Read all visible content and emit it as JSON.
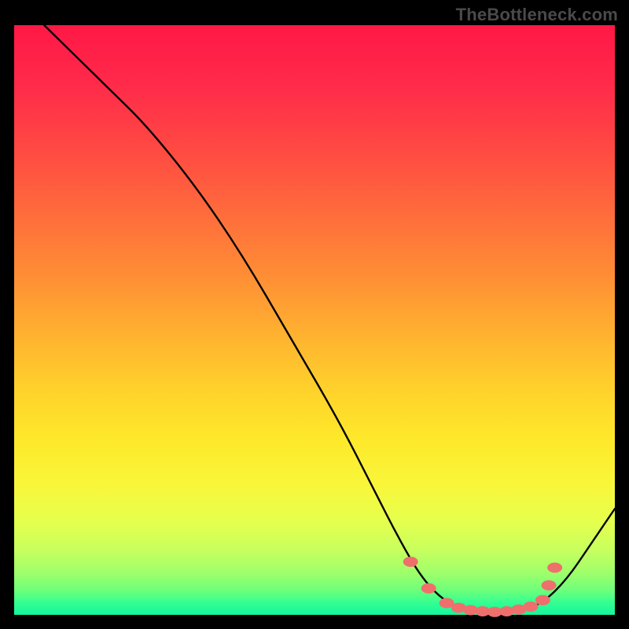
{
  "watermark": "TheBottleneck.com",
  "colors": {
    "background": "#000000",
    "gradient_top": "#ff1846",
    "gradient_mid": "#fee82a",
    "gradient_bottom": "#14f59c",
    "curve": "#000000",
    "dots": "#ef6f6d"
  },
  "chart_data": {
    "type": "line",
    "title": "",
    "xlabel": "",
    "ylabel": "",
    "xlim": [
      0,
      100
    ],
    "ylim": [
      0,
      100
    ],
    "grid": false,
    "legend": false,
    "curve": [
      {
        "x": 5,
        "y": 100
      },
      {
        "x": 10,
        "y": 95
      },
      {
        "x": 16,
        "y": 89
      },
      {
        "x": 22,
        "y": 83
      },
      {
        "x": 30,
        "y": 73
      },
      {
        "x": 38,
        "y": 61
      },
      {
        "x": 46,
        "y": 47
      },
      {
        "x": 54,
        "y": 33
      },
      {
        "x": 60,
        "y": 21
      },
      {
        "x": 64,
        "y": 13
      },
      {
        "x": 68,
        "y": 6
      },
      {
        "x": 72,
        "y": 2
      },
      {
        "x": 76,
        "y": 0.5
      },
      {
        "x": 80,
        "y": 0.3
      },
      {
        "x": 84,
        "y": 0.5
      },
      {
        "x": 88,
        "y": 2
      },
      {
        "x": 92,
        "y": 6
      },
      {
        "x": 96,
        "y": 12
      },
      {
        "x": 100,
        "y": 18
      }
    ],
    "highlight_points": [
      {
        "x": 66,
        "y": 9
      },
      {
        "x": 69,
        "y": 4.5
      },
      {
        "x": 72,
        "y": 2
      },
      {
        "x": 74,
        "y": 1.2
      },
      {
        "x": 76,
        "y": 0.8
      },
      {
        "x": 78,
        "y": 0.6
      },
      {
        "x": 80,
        "y": 0.5
      },
      {
        "x": 82,
        "y": 0.6
      },
      {
        "x": 84,
        "y": 0.9
      },
      {
        "x": 86,
        "y": 1.4
      },
      {
        "x": 88,
        "y": 2.5
      },
      {
        "x": 89,
        "y": 5
      },
      {
        "x": 90,
        "y": 8
      }
    ]
  }
}
